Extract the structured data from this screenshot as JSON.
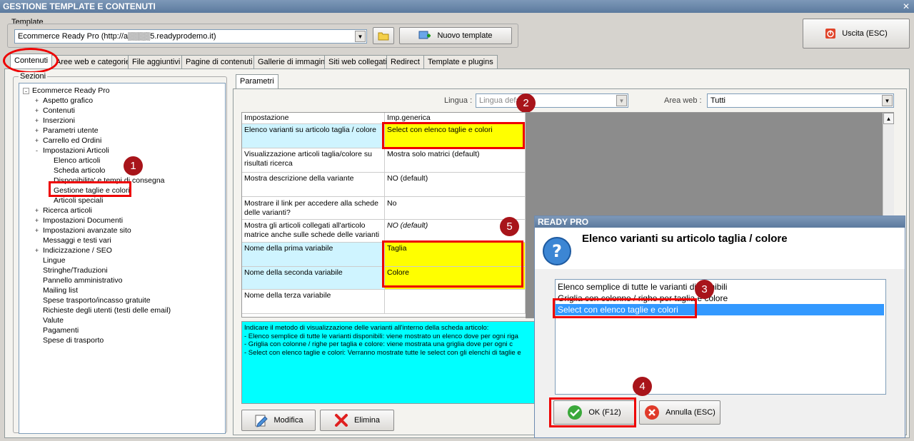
{
  "window": {
    "title": "GESTIONE TEMPLATE E CONTENUTI",
    "close": "✕"
  },
  "template": {
    "label": "Template",
    "value": "Ecommerce Ready Pro (http://a▒▒▒▒5.readyprodemo.it)",
    "new_button": "Nuovo template",
    "exit_button": "Uscita (ESC)"
  },
  "tabs": [
    "Contenuti",
    "Aree web e categorie",
    "File aggiuntivi",
    "Pagine di contenuti",
    "Gallerie di immagini",
    "Siti web collegati",
    "Redirect",
    "Template e plugins"
  ],
  "sections": {
    "label": "Sezioni",
    "tree": [
      {
        "label": "Ecommerce Ready Pro",
        "level": 0,
        "exp": "-"
      },
      {
        "label": "Aspetto grafico",
        "level": 1,
        "exp": "+"
      },
      {
        "label": "Contenuti",
        "level": 1,
        "exp": "+"
      },
      {
        "label": "Inserzioni",
        "level": 1,
        "exp": "+"
      },
      {
        "label": "Parametri utente",
        "level": 1,
        "exp": "+"
      },
      {
        "label": "Carrello ed Ordini",
        "level": 1,
        "exp": "+"
      },
      {
        "label": "Impostazioni Articoli",
        "level": 1,
        "exp": "-"
      },
      {
        "label": "Elenco articoli",
        "level": 2,
        "exp": ""
      },
      {
        "label": "Scheda articolo",
        "level": 2,
        "exp": ""
      },
      {
        "label": "Disponibilita' e tempi di consegna",
        "level": 2,
        "exp": ""
      },
      {
        "label": "Gestione taglie e colori",
        "level": 2,
        "exp": ""
      },
      {
        "label": "Articoli speciali",
        "level": 2,
        "exp": ""
      },
      {
        "label": "Ricerca articoli",
        "level": 1,
        "exp": "+"
      },
      {
        "label": "Impostazioni Documenti",
        "level": 1,
        "exp": "+"
      },
      {
        "label": "Impostazioni avanzate sito",
        "level": 1,
        "exp": "+"
      },
      {
        "label": "Messaggi e testi vari",
        "level": 1,
        "exp": ""
      },
      {
        "label": "Indicizzazione / SEO",
        "level": 1,
        "exp": "+"
      },
      {
        "label": "Lingue",
        "level": 1,
        "exp": ""
      },
      {
        "label": "Stringhe/Traduzioni",
        "level": 1,
        "exp": ""
      },
      {
        "label": "Pannello amministrativo",
        "level": 1,
        "exp": ""
      },
      {
        "label": "Mailing list",
        "level": 1,
        "exp": ""
      },
      {
        "label": "Spese trasporto/incasso gratuite",
        "level": 1,
        "exp": ""
      },
      {
        "label": "Richieste degli utenti (testi delle email)",
        "level": 1,
        "exp": ""
      },
      {
        "label": "Valute",
        "level": 1,
        "exp": ""
      },
      {
        "label": "Pagamenti",
        "level": 1,
        "exp": ""
      },
      {
        "label": "Spese di trasporto",
        "level": 1,
        "exp": ""
      }
    ]
  },
  "params": {
    "tab": "Parametri",
    "lingua_label": "Lingua :",
    "lingua_value": "Lingua defa",
    "area_label": "Area web :",
    "area_value": "Tutti",
    "col_setting": "Impostazione",
    "col_value": "Imp.generica",
    "rows": [
      {
        "setting": "Elenco varianti su articolo taglia / colore",
        "value": "Select con elenco taglie e colori"
      },
      {
        "setting": "Visualizzazione articoli taglia/colore su risultati ricerca",
        "value": "Mostra solo matrici (default)"
      },
      {
        "setting": "Mostra descrizione della variante",
        "value": "NO (default)"
      },
      {
        "setting": "Mostrare il link per accedere alla schede delle varianti?",
        "value": "No"
      },
      {
        "setting": "Mostra gli articoli collegati all'articolo matrice anche sulle schede delle varianti",
        "value": "NO (default)"
      },
      {
        "setting": "Nome della prima variabile",
        "value": "Taglia"
      },
      {
        "setting": "Nome della seconda variabile",
        "value": "Colore"
      },
      {
        "setting": "Nome della terza variabile",
        "value": ""
      }
    ],
    "desc": [
      "Indicare il metodo di visualizzazione delle varianti all'interno della scheda articolo:",
      "- Elenco semplice di tutte le varianti disponibili: viene mostrato un elenco dove per ogni riga",
      "- Griglia con colonne / righe per taglia e colore: viene mostrata una griglia dove per ogni c",
      "- Select con elenco taglie e colori: Verranno mostrate tutte le select con gli elenchi di taglie e"
    ],
    "modify_button": "Modifica",
    "delete_button": "Elimina"
  },
  "dialog": {
    "title": "READY PRO",
    "heading": "Elenco varianti su articolo taglia / colore",
    "options": [
      "Elenco semplice di tutte le varianti disponibili",
      "Griglia con colonne / righe per taglia e colore",
      "Select con elenco taglie e colori"
    ],
    "ok": "OK (F12)",
    "cancel": "Annulla (ESC)"
  },
  "badges": [
    "1",
    "2",
    "3",
    "4",
    "5"
  ],
  "colors": {
    "accent_red": "#e00000",
    "badge": "#a8141a",
    "highlight_yellow": "#ffff00",
    "desc_bg": "#00ffff",
    "selection": "#3399ff"
  }
}
